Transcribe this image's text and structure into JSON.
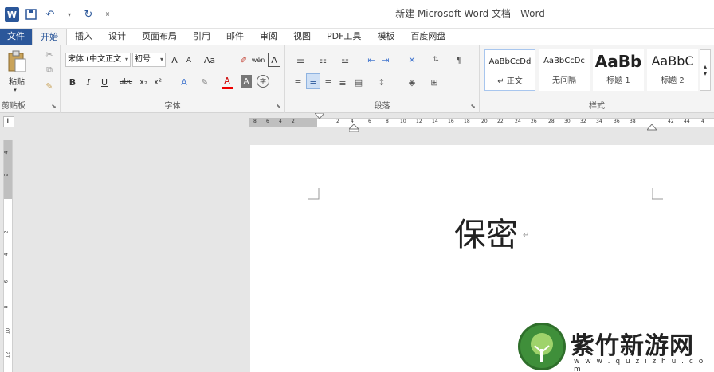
{
  "title_bar": {
    "document_title": "新建 Microsoft Word 文档 - Word",
    "quick_access": [
      "word-logo",
      "save-icon",
      "undo-icon",
      "dropdown-icon",
      "redo-icon",
      "customize-icon"
    ]
  },
  "tabs": [
    {
      "label": "文件",
      "kind": "file"
    },
    {
      "label": "开始",
      "kind": "active"
    },
    {
      "label": "插入"
    },
    {
      "label": "设计"
    },
    {
      "label": "页面布局"
    },
    {
      "label": "引用"
    },
    {
      "label": "邮件"
    },
    {
      "label": "审阅"
    },
    {
      "label": "视图"
    },
    {
      "label": "PDF工具"
    },
    {
      "label": "模板"
    },
    {
      "label": "百度网盘"
    }
  ],
  "ribbon": {
    "clipboard": {
      "label": "剪贴板",
      "paste_label": "粘贴"
    },
    "font": {
      "label": "字体",
      "font_name": "宋体 (中文正文",
      "font_size": "初号",
      "grow_font": "A",
      "shrink_font": "A",
      "change_case": "Aa",
      "phonetic": "wén",
      "char_border": "A",
      "bold": "B",
      "italic": "I",
      "underline": "U",
      "strikethrough": "abc",
      "subscript": "x₂",
      "superscript": "x²",
      "text_effects": "A",
      "font_color": "A",
      "char_shading": "A",
      "enclose": "字"
    },
    "paragraph": {
      "label": "段落"
    },
    "styles": {
      "label": "样式",
      "items": [
        {
          "sample": "AaBbCcDd",
          "name": "↵ 正文",
          "selected": true
        },
        {
          "sample": "AaBbCcDc",
          "name": "无间隔"
        },
        {
          "sample": "AaBb",
          "name": "标题 1"
        },
        {
          "sample": "AaBbC",
          "name": "标题 2"
        }
      ]
    }
  },
  "ruler": {
    "tab_selector": "L",
    "numbers": [
      "8",
      "6",
      "4",
      "2",
      "2",
      "4",
      "6",
      "8",
      "10",
      "12",
      "14",
      "16",
      "18",
      "20",
      "22",
      "24",
      "26",
      "28",
      "30",
      "32",
      "34",
      "36",
      "38",
      "42",
      "44",
      "4"
    ]
  },
  "vertical_ruler": {
    "numbers": [
      "4",
      "2",
      "2",
      "4",
      "6",
      "8",
      "10",
      "12"
    ]
  },
  "document": {
    "heading": "保密",
    "paragraph_mark": "↵"
  },
  "watermark": {
    "brand": "紫竹新游网",
    "url": "w w w . q u z i z h u . c o m"
  }
}
